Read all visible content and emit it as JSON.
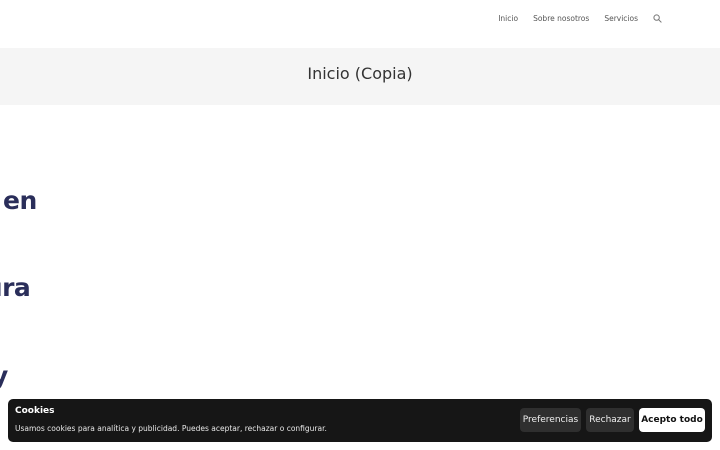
{
  "nav": {
    "items": [
      "Inicio",
      "Sobre nosotros",
      "Servicios"
    ],
    "search_icon": "search-icon"
  },
  "page": {
    "title": "Inicio (Copia)"
  },
  "hero": {
    "words": [
      "en",
      "ıra",
      "y"
    ],
    "color": "#2a2e5a"
  },
  "cookie_banner": {
    "title": "Cookies",
    "text": "Usamos cookies para analítica y publicidad. Puedes aceptar, rechazar o configurar.",
    "preferences_label": "Preferencias",
    "reject_label": "Rechazar",
    "accept_label": "Acepto todo",
    "background": "#161616"
  }
}
